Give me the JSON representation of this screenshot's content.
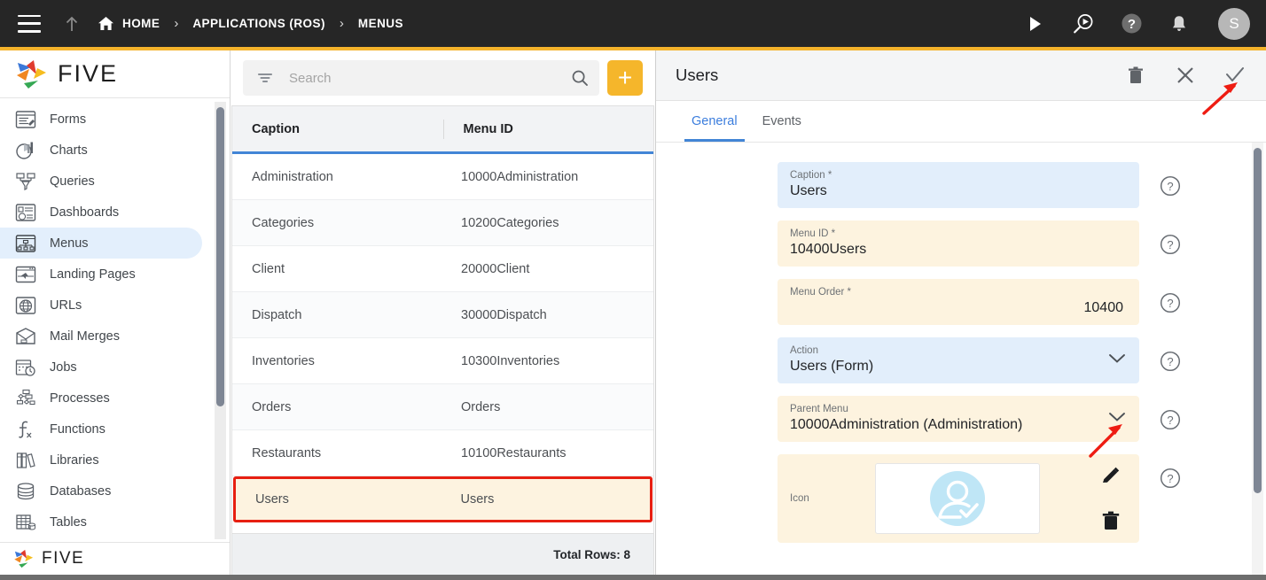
{
  "topbar": {
    "menu_icon": "hamburger-icon",
    "up_icon": "arrow-up-icon",
    "breadcrumbs": [
      {
        "label": "HOME",
        "icon": "home-icon"
      },
      {
        "label": "APPLICATIONS (ROS)",
        "icon": ""
      },
      {
        "label": "MENUS",
        "icon": ""
      }
    ],
    "separator": "›",
    "actions": [
      {
        "name": "run-icon",
        "glyph": "▶"
      },
      {
        "name": "preview-search-icon",
        "glyph": ""
      },
      {
        "name": "help-icon",
        "glyph": "?"
      },
      {
        "name": "notifications-bell-icon",
        "glyph": ""
      }
    ],
    "avatar_initial": "S",
    "accent_color": "#f5b32b",
    "background": "#262626"
  },
  "sidebar": {
    "logo_text": "FIVE",
    "footer_logo_text": "FIVE",
    "items": [
      {
        "label": "Forms",
        "icon": "forms-icon",
        "active": false
      },
      {
        "label": "Charts",
        "icon": "charts-icon",
        "active": false
      },
      {
        "label": "Queries",
        "icon": "queries-icon",
        "active": false
      },
      {
        "label": "Dashboards",
        "icon": "dashboards-icon",
        "active": false
      },
      {
        "label": "Menus",
        "icon": "menus-icon",
        "active": true
      },
      {
        "label": "Landing Pages",
        "icon": "landing-pages-icon",
        "active": false
      },
      {
        "label": "URLs",
        "icon": "urls-icon",
        "active": false
      },
      {
        "label": "Mail Merges",
        "icon": "mail-merges-icon",
        "active": false
      },
      {
        "label": "Jobs",
        "icon": "jobs-icon",
        "active": false
      },
      {
        "label": "Processes",
        "icon": "processes-icon",
        "active": false
      },
      {
        "label": "Functions",
        "icon": "functions-icon",
        "active": false
      },
      {
        "label": "Libraries",
        "icon": "libraries-icon",
        "active": false
      },
      {
        "label": "Databases",
        "icon": "databases-icon",
        "active": false
      },
      {
        "label": "Tables",
        "icon": "tables-icon",
        "active": false
      }
    ],
    "active_bg": "#e3effc"
  },
  "list_panel": {
    "search": {
      "placeholder": "Search",
      "value": ""
    },
    "filter_icon": "filter-icon",
    "search_icon": "search-icon",
    "add_label": "+",
    "add_color": "#f5b62b",
    "columns": [
      "Caption",
      "Menu ID"
    ],
    "rows": [
      {
        "caption": "Administration",
        "menu_id": "10000Administration",
        "selected": false
      },
      {
        "caption": "Categories",
        "menu_id": "10200Categories",
        "selected": false
      },
      {
        "caption": "Client",
        "menu_id": "20000Client",
        "selected": false
      },
      {
        "caption": "Dispatch",
        "menu_id": "30000Dispatch",
        "selected": false
      },
      {
        "caption": "Inventories",
        "menu_id": "10300Inventories",
        "selected": false
      },
      {
        "caption": "Orders",
        "menu_id": "Orders",
        "selected": false
      },
      {
        "caption": "Restaurants",
        "menu_id": "10100Restaurants",
        "selected": false
      },
      {
        "caption": "Users",
        "menu_id": "Users",
        "selected": true
      }
    ],
    "footer": "Total Rows: 8",
    "selection_outline_color": "#e71f11",
    "selected_row_bg": "#fdf3e0"
  },
  "detail_panel": {
    "title": "Users",
    "actions": [
      {
        "name": "delete-icon",
        "label": "Delete"
      },
      {
        "name": "close-icon",
        "label": "Close"
      },
      {
        "name": "save-check-icon",
        "label": "Save"
      }
    ],
    "tabs": [
      {
        "label": "General",
        "active": true
      },
      {
        "label": "Events",
        "active": false
      }
    ],
    "fields": [
      {
        "name": "caption",
        "label": "Caption *",
        "value": "Users",
        "style": "blue",
        "type": "text",
        "align": "left"
      },
      {
        "name": "menu-id",
        "label": "Menu ID *",
        "value": "10400Users",
        "style": "cream",
        "type": "text",
        "align": "left"
      },
      {
        "name": "menu-order",
        "label": "Menu Order *",
        "value": "10400",
        "style": "cream",
        "type": "number",
        "align": "right"
      },
      {
        "name": "action",
        "label": "Action",
        "value": "Users (Form)",
        "style": "blue",
        "type": "select",
        "align": "left"
      },
      {
        "name": "parent-menu",
        "label": "Parent Menu",
        "value": "10000Administration (Administration)",
        "style": "cream",
        "type": "select",
        "align": "left"
      }
    ],
    "icon_field": {
      "label": "Icon",
      "preview_icon": "user-check-avatar-icon",
      "preview_color": "#b8e4f5",
      "edit_icon": "pencil-icon",
      "delete_icon": "trash-icon"
    },
    "help_icon": "help-circle-icon"
  },
  "annotations": {
    "arrows": [
      {
        "name": "arrow-to-save-check",
        "color": "#ee1c12"
      },
      {
        "name": "arrow-to-parent-menu-dropdown",
        "color": "#ee1c12"
      }
    ]
  }
}
